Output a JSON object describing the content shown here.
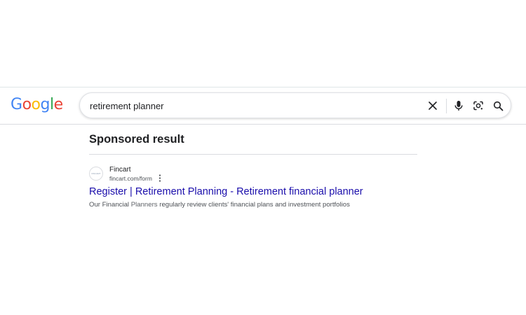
{
  "header": {
    "logo": {
      "letters": [
        "G",
        "o",
        "o",
        "g",
        "l",
        "e"
      ],
      "colors": [
        "#4285F4",
        "#EA4335",
        "#FBBC05",
        "#4285F4",
        "#34A853",
        "#EA4335"
      ]
    },
    "search": {
      "value": "retirement planner"
    },
    "icons": {
      "clear": "close-icon",
      "voice": "microphone-icon",
      "lens": "camera-lens-icon",
      "search": "search-icon"
    }
  },
  "results": {
    "heading": "Sponsored result",
    "ad": {
      "favicon_text": "FINCART",
      "source_name": "Fincart",
      "display_url": "fincart.com/form",
      "title": "Register | Retirement Planning - Retirement financial planner",
      "description_parts": [
        {
          "text": "Our Financial ",
          "highlight": false
        },
        {
          "text": "Planners",
          "highlight": true
        },
        {
          "text": " regularly review clients' financial plans and investment portfolios",
          "highlight": false
        }
      ]
    }
  },
  "colors": {
    "link": "#1a0dab",
    "text": "#202124",
    "muted": "#4d5156",
    "icon": "#202124"
  }
}
